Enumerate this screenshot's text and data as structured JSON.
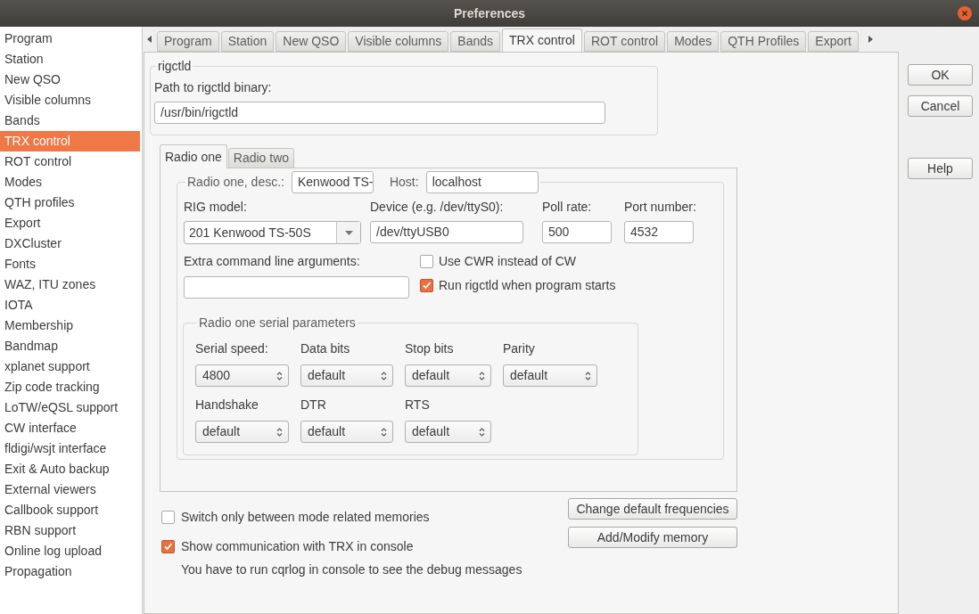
{
  "window": {
    "title": "Preferences"
  },
  "sidebar": {
    "items": [
      {
        "label": "Program",
        "selected": false
      },
      {
        "label": "Station",
        "selected": false
      },
      {
        "label": "New QSO",
        "selected": false
      },
      {
        "label": "Visible columns",
        "selected": false
      },
      {
        "label": "Bands",
        "selected": false
      },
      {
        "label": "TRX control",
        "selected": true
      },
      {
        "label": "ROT control",
        "selected": false
      },
      {
        "label": "Modes",
        "selected": false
      },
      {
        "label": "QTH profiles",
        "selected": false
      },
      {
        "label": "Export",
        "selected": false
      },
      {
        "label": "DXCluster",
        "selected": false
      },
      {
        "label": "Fonts",
        "selected": false
      },
      {
        "label": "WAZ, ITU zones",
        "selected": false
      },
      {
        "label": "IOTA",
        "selected": false
      },
      {
        "label": "Membership",
        "selected": false
      },
      {
        "label": "Bandmap",
        "selected": false
      },
      {
        "label": "xplanet support",
        "selected": false
      },
      {
        "label": "Zip code tracking",
        "selected": false
      },
      {
        "label": "LoTW/eQSL support",
        "selected": false
      },
      {
        "label": "CW interface",
        "selected": false
      },
      {
        "label": "fldigi/wsjt interface",
        "selected": false
      },
      {
        "label": "Exit & Auto backup",
        "selected": false
      },
      {
        "label": "External viewers",
        "selected": false
      },
      {
        "label": "Callbook support",
        "selected": false
      },
      {
        "label": "RBN support",
        "selected": false
      },
      {
        "label": "Online log upload",
        "selected": false
      },
      {
        "label": "Propagation",
        "selected": false
      }
    ]
  },
  "tabs": [
    {
      "label": "Program",
      "selected": false
    },
    {
      "label": "Station",
      "selected": false
    },
    {
      "label": "New QSO",
      "selected": false
    },
    {
      "label": "Visible columns",
      "selected": false
    },
    {
      "label": "Bands",
      "selected": false
    },
    {
      "label": "TRX control",
      "selected": true
    },
    {
      "label": "ROT control",
      "selected": false
    },
    {
      "label": "Modes",
      "selected": false
    },
    {
      "label": "QTH Profiles",
      "selected": false
    },
    {
      "label": "Export",
      "selected": false
    }
  ],
  "rigctld": {
    "legend": "rigctld",
    "path_label": "Path to rigctld binary:",
    "path_value": "/usr/bin/rigctld"
  },
  "radio_tabs": [
    {
      "label": "Radio one",
      "selected": true
    },
    {
      "label": "Radio two",
      "selected": false
    }
  ],
  "radio": {
    "desc_label": "Radio one, desc.:",
    "desc_value": "Kenwood TS-",
    "host_label": "Host:",
    "host_value": "localhost",
    "rig_model_label": "RIG model:",
    "rig_model_value": "201 Kenwood TS-50S",
    "device_label": "Device (e.g. /dev/ttyS0):",
    "device_value": "/dev/ttyUSB0",
    "poll_label": "Poll rate:",
    "poll_value": "500",
    "port_label": "Port number:",
    "port_value": "4532",
    "extra_label": "Extra command line arguments:",
    "checkboxes": [
      {
        "label": "Use CWR instead of CW",
        "checked": false
      },
      {
        "label": "Run rigctld when program starts",
        "checked": true
      }
    ],
    "serial": {
      "legend": "Radio one serial parameters",
      "fields": [
        {
          "label": "Serial speed:",
          "value": "4800"
        },
        {
          "label": "Data bits",
          "value": "default"
        },
        {
          "label": "Stop bits",
          "value": "default"
        },
        {
          "label": "Parity",
          "value": "default"
        },
        {
          "label": "Handshake",
          "value": "default"
        },
        {
          "label": "DTR",
          "value": "default"
        },
        {
          "label": "RTS",
          "value": "default"
        }
      ]
    }
  },
  "memory_checkbox": {
    "label": "Switch only between mode related memories",
    "checked": false
  },
  "console_checkbox": {
    "label": "Show communication with TRX in console",
    "checked": true,
    "note": "You have to run cqrlog in console to see the debug messages"
  },
  "panel_buttons": [
    "Change default frequencies",
    "Add/Modify memory"
  ],
  "dialog_buttons": [
    "OK",
    "Cancel",
    "Help"
  ]
}
